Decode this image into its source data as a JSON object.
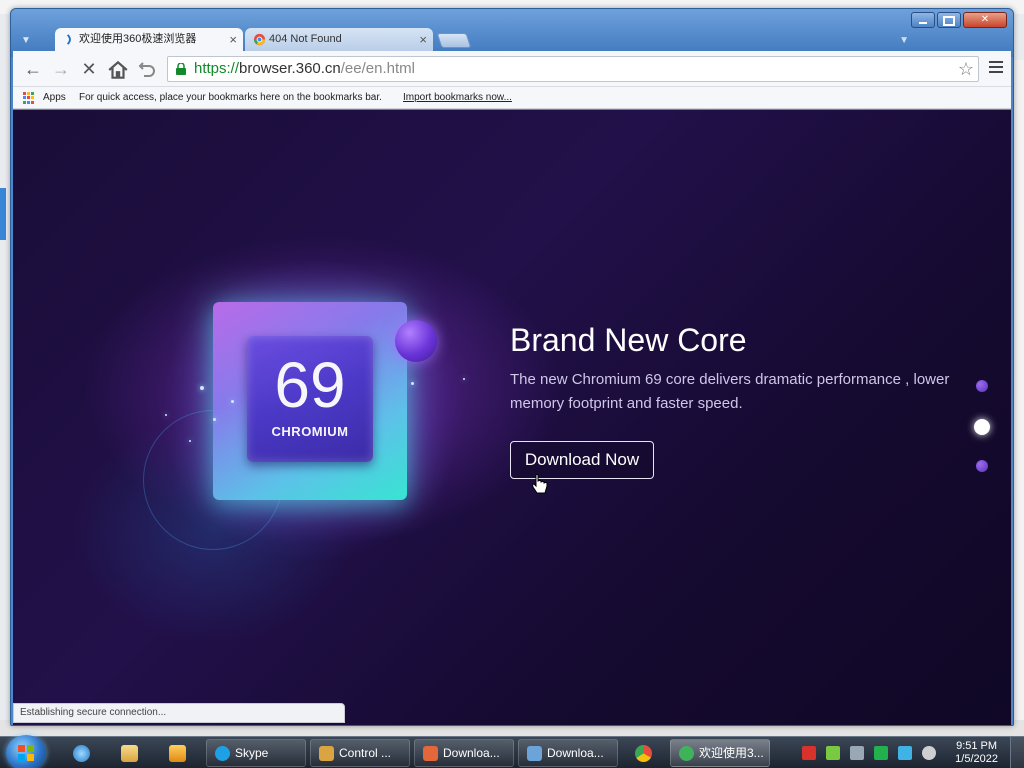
{
  "browser": {
    "tabs": [
      {
        "label": "欢迎使用360极速浏览器",
        "active": true,
        "icon": "360-browser-icon"
      },
      {
        "label": "404 Not Found",
        "active": false,
        "icon": "chrome-icon"
      }
    ],
    "url": {
      "scheme": "https://",
      "host": "browser.360.cn",
      "path": "/ee/en.html"
    },
    "bookmarks": {
      "apps_label": "Apps",
      "hint": "For quick access, place your bookmarks here on the bookmarks bar.",
      "import_link": "Import bookmarks now..."
    },
    "status": "Establishing secure connection..."
  },
  "page": {
    "chip": {
      "number": "69",
      "label": "CHROMIUM"
    },
    "title": "Brand New Core",
    "description": "The new Chromium 69 core delivers dramatic performance , lower memory footprint and faster speed.",
    "download_label": "Download Now",
    "carousel": {
      "count": 3,
      "active_index": 1
    }
  },
  "taskbar": {
    "items": [
      {
        "label": "Skype",
        "icon": "skype-icon",
        "color": "#1ea0e6"
      },
      {
        "label": "Control ...",
        "icon": "control-panel-icon",
        "color": "#d9a441"
      },
      {
        "label": "Downloa...",
        "icon": "download-icon",
        "color": "#e2673a"
      },
      {
        "label": "Downloa...",
        "icon": "download-folder-icon",
        "color": "#6ca3d8"
      },
      {
        "label": "欢迎使用3...",
        "icon": "360-browser-icon",
        "color": "#3fb35a"
      }
    ],
    "clock": {
      "time": "9:51 PM",
      "date": "1/5/2022"
    }
  },
  "colors": {
    "page_bg": "#1a0d38",
    "accent_cyan": "#38f0d8",
    "accent_purple": "#8a7ff0",
    "url_secure": "#118a2b"
  }
}
